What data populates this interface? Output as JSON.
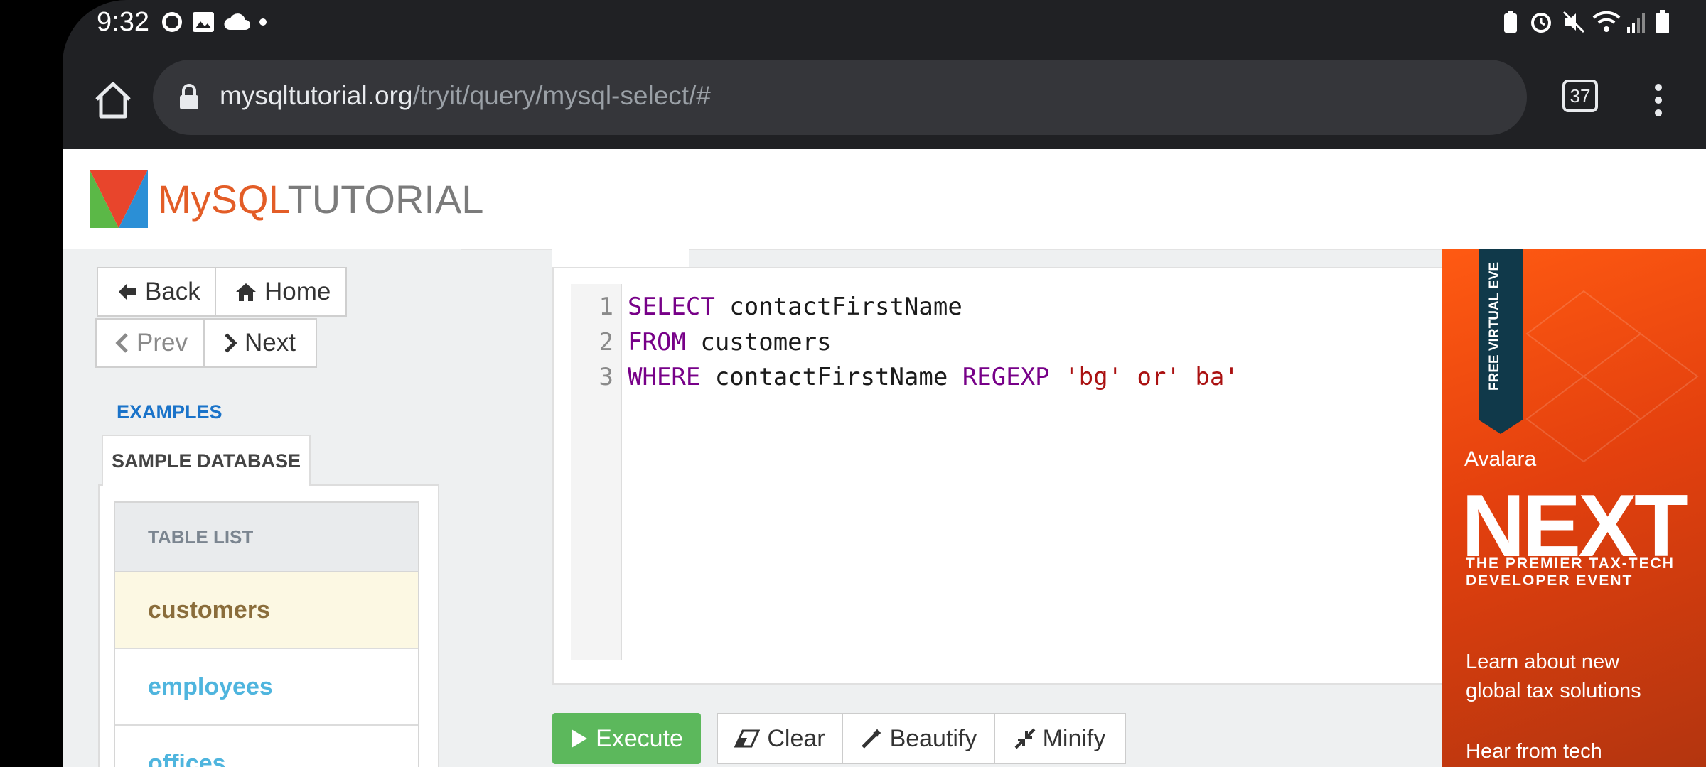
{
  "status_bar": {
    "time": "9:32"
  },
  "browser": {
    "url_host": "mysqltutorial.org",
    "url_path": "/tryit/query/mysql-select/#",
    "tab_count": "37"
  },
  "site": {
    "logo_my": "MySQL",
    "logo_tutorial": "TUTORIAL"
  },
  "nav": {
    "back": "Back",
    "home": "Home",
    "prev": "Prev",
    "next": "Next"
  },
  "sidebar": {
    "examples_link": "EXAMPLES",
    "sample_tab": "SAMPLE DATABASE",
    "table_list_header": "TABLE LIST",
    "tables": [
      "customers",
      "employees",
      "offices"
    ]
  },
  "editor": {
    "line_numbers": [
      "1",
      "2",
      "3"
    ],
    "lines": [
      {
        "kw": "SELECT",
        "rest": " contactFirstName"
      },
      {
        "kw": "FROM",
        "rest": " customers"
      },
      {
        "kw": "WHERE",
        "mid": " contactFirstName ",
        "kw2": "REGEXP",
        "str": " 'bg' or' ba'"
      }
    ]
  },
  "toolbar": {
    "execute": "Execute",
    "clear": "Clear",
    "beautify": "Beautify",
    "minify": "Minify"
  },
  "ad": {
    "ribbon": "FREE VIRTUAL EVE",
    "brand": "Avalara",
    "headline": "NEXT",
    "sub1": "THE PREMIER TAX-TECH",
    "sub2": "DEVELOPER EVENT",
    "line1": "Learn about new",
    "line2": "global tax solutions",
    "line3": "Hear from tech"
  },
  "colors": {
    "execute_green": "#5cb85c",
    "keyword": "#770088",
    "string": "#aa1111",
    "active_row": "#fcf8e3",
    "link_blue": "#4fb5de"
  }
}
